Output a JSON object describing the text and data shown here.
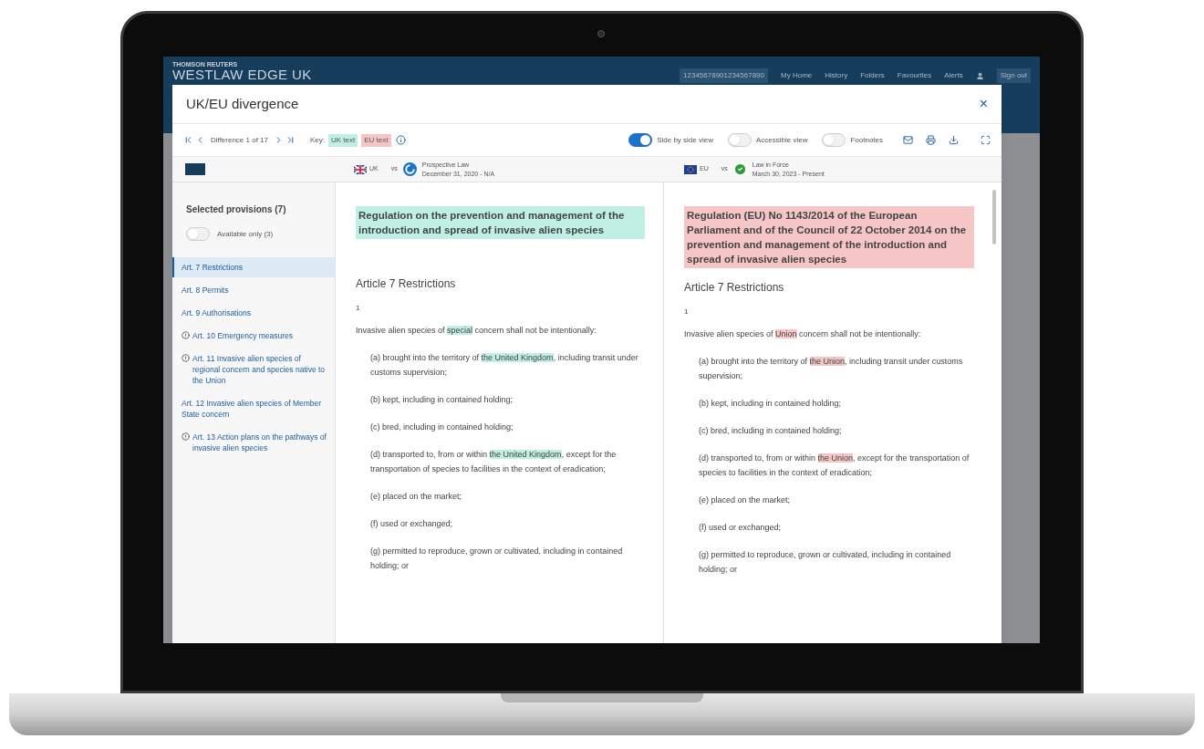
{
  "app_header": {
    "brand_small": "THOMSON REUTERS",
    "brand": "WESTLAW EDGE UK",
    "client_id": "12345678901234567890",
    "nav": [
      "My Home",
      "History",
      "Folders",
      "Favourites",
      "Alerts"
    ],
    "sign_out": "Sign out"
  },
  "modal": {
    "title": "UK/EU divergence",
    "close": "×",
    "navigator": {
      "label": "Difference 1 of 17"
    },
    "key": {
      "label": "Key:",
      "items": [
        {
          "label": "UK text",
          "color": "#bff0e3"
        },
        {
          "label": "EU text",
          "color": "#f6c6c6"
        }
      ]
    },
    "toggles": [
      {
        "label": "Side by side view",
        "on": true
      },
      {
        "label": "Accessible view",
        "on": false
      },
      {
        "label": "Footnotes",
        "on": false
      }
    ],
    "versions": [
      {
        "code": "UK",
        "vs": "vs",
        "status": "Prospective Law",
        "dates": "December 31, 2020 - N/A",
        "kind": "prospective"
      },
      {
        "code": "EU",
        "vs": "vs",
        "status": "Law in Force",
        "dates": "March 30, 2023 - Present",
        "kind": "in_force"
      }
    ],
    "sidebar": {
      "title": "Selected provisions (7)",
      "filter": {
        "label": "Available only (3)",
        "on": false
      },
      "items": [
        {
          "label": "Art. 7 Restrictions",
          "selected": true,
          "warning": false
        },
        {
          "label": "Art. 8 Permits",
          "selected": false,
          "warning": false
        },
        {
          "label": "Art. 9 Authorisations",
          "selected": false,
          "warning": false
        },
        {
          "label": "Art. 10 Emergency measures",
          "selected": false,
          "warning": true
        },
        {
          "label": "Art. 11 Invasive alien species of regional concern and species native to the Union",
          "selected": false,
          "warning": true
        },
        {
          "label": "Art. 12 Invasive alien species of Member State concern",
          "selected": false,
          "warning": false
        },
        {
          "label": "Art. 13 Action plans on the pathways of invasive alien species",
          "selected": false,
          "warning": true
        }
      ]
    },
    "columns": [
      {
        "color": "#bff0e3",
        "heading": "Regulation on the prevention and management of the introduction and spread of invasive alien species",
        "article_title": "Article 7 Restrictions",
        "number": "1",
        "paragraphs": [
          {
            "indent": false,
            "segments": [
              {
                "text": "Invasive alien species of ",
                "highlight": false
              },
              {
                "text": "special",
                "highlight": true
              },
              {
                "text": " concern shall not be intentionally:",
                "highlight": false
              }
            ]
          },
          {
            "indent": true,
            "segments": [
              {
                "text": "(a) brought into the territory of ",
                "highlight": false
              },
              {
                "text": "the United Kingdom",
                "highlight": true
              },
              {
                "text": ", including transit under customs supervision;",
                "highlight": false
              }
            ]
          },
          {
            "indent": true,
            "segments": [
              {
                "text": "(b) kept, including in contained holding;",
                "highlight": false
              }
            ]
          },
          {
            "indent": true,
            "segments": [
              {
                "text": "(c) bred, including in contained holding;",
                "highlight": false
              }
            ]
          },
          {
            "indent": true,
            "segments": [
              {
                "text": "(d) transported to, from or within ",
                "highlight": false
              },
              {
                "text": "the United Kingdom",
                "highlight": true
              },
              {
                "text": ", except for the transportation of species to facilities in the context of eradication;",
                "highlight": false
              }
            ]
          },
          {
            "indent": true,
            "segments": [
              {
                "text": "(e) placed on the market;",
                "highlight": false
              }
            ]
          },
          {
            "indent": true,
            "segments": [
              {
                "text": "(f) used or exchanged;",
                "highlight": false
              }
            ]
          },
          {
            "indent": true,
            "segments": [
              {
                "text": "(g) permitted to reproduce, grown or cultivated, including in contained holding; or",
                "highlight": false
              }
            ]
          }
        ]
      },
      {
        "color": "#f6c6c6",
        "heading": "Regulation (EU) No 1143/2014 of the European Parliament and of the Council of 22 October 2014 on the prevention and management of the introduction and spread of invasive alien species",
        "article_title": "Article 7 Restrictions",
        "number": "1",
        "paragraphs": [
          {
            "indent": false,
            "segments": [
              {
                "text": "Invasive alien species of ",
                "highlight": false
              },
              {
                "text": "Union",
                "highlight": true
              },
              {
                "text": " concern shall not be intentionally:",
                "highlight": false
              }
            ]
          },
          {
            "indent": true,
            "segments": [
              {
                "text": "(a) brought into the territory of ",
                "highlight": false
              },
              {
                "text": "the Union",
                "highlight": true
              },
              {
                "text": ", including transit under customs supervision;",
                "highlight": false
              }
            ]
          },
          {
            "indent": true,
            "segments": [
              {
                "text": "(b) kept, including in contained holding;",
                "highlight": false
              }
            ]
          },
          {
            "indent": true,
            "segments": [
              {
                "text": "(c) bred, including in contained holding;",
                "highlight": false
              }
            ]
          },
          {
            "indent": true,
            "segments": [
              {
                "text": "(d) transported to, from or within ",
                "highlight": false
              },
              {
                "text": "the Union",
                "highlight": true
              },
              {
                "text": ", except for the transportation of species to facilities in the context of eradication;",
                "highlight": false
              }
            ]
          },
          {
            "indent": true,
            "segments": [
              {
                "text": "(e) placed on the market;",
                "highlight": false
              }
            ]
          },
          {
            "indent": true,
            "segments": [
              {
                "text": "(f) used or exchanged;",
                "highlight": false
              }
            ]
          },
          {
            "indent": true,
            "segments": [
              {
                "text": "(g) permitted to reproduce, grown or cultivated, including in contained holding; or",
                "highlight": false
              }
            ]
          }
        ]
      }
    ]
  }
}
